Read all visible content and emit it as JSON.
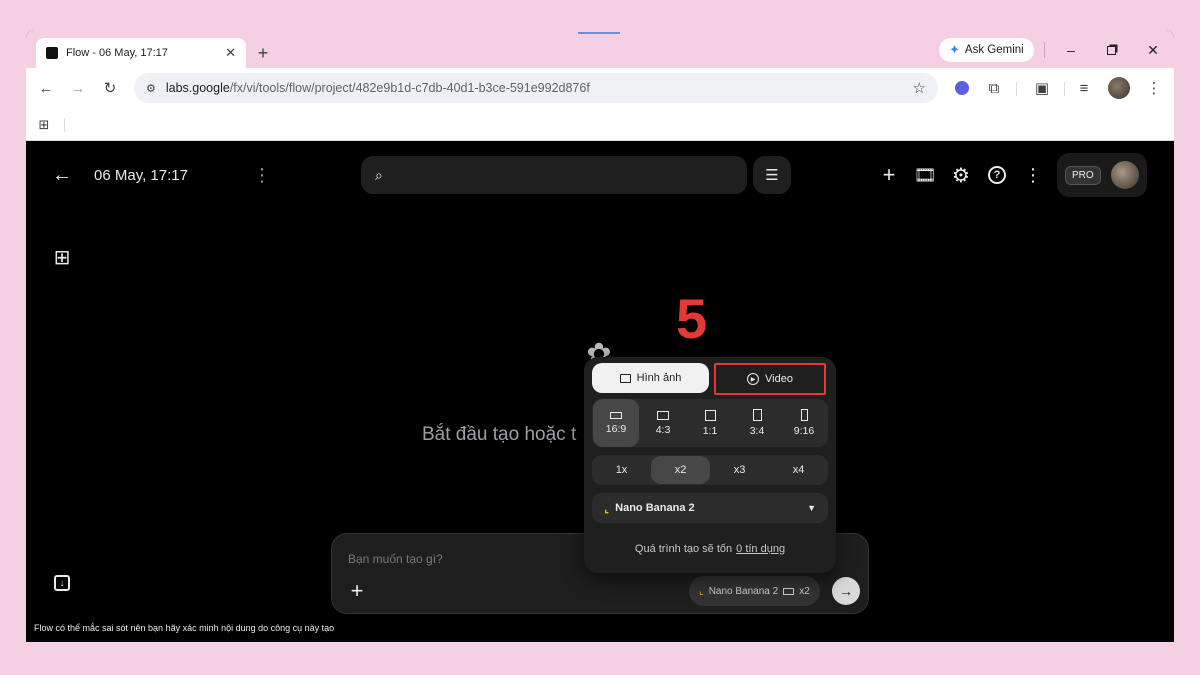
{
  "browser": {
    "tab_title": "Flow - 06 May, 17:17",
    "new_tab_symbol": "+",
    "ask_gemini_label": "Ask Gemini",
    "url_host": "labs.google",
    "url_path": "/fx/vi/tools/flow/project/482e9b1d-c7db-40d1-b3ce-591e992d876f"
  },
  "app": {
    "project_title": "06 May, 17:17",
    "pro_badge": "PRO",
    "empty_state_text": "Bắt đầu tạo hoặc t",
    "prompt_placeholder": "Bạn muốn tạo gì?",
    "prompt_chip_model": "Nano Banana 2",
    "prompt_chip_count": "x2",
    "footer_disclaimer": "Flow có thể mắc sai sót nên bạn hãy xác minh nội dung do công cụ này tạo",
    "annotation_number": "5"
  },
  "popover": {
    "image_tab_label": "Hình ảnh",
    "video_tab_label": "Video",
    "aspect_ratios": [
      "16:9",
      "4:3",
      "1:1",
      "3:4",
      "9:16"
    ],
    "selected_ratio": "16:9",
    "multipliers": [
      "1x",
      "x2",
      "x3",
      "x4"
    ],
    "selected_multiplier": "x2",
    "model_label": "Nano Banana 2",
    "cost_text": "Quá trình tạo sẽ tốn",
    "cost_link": "0 tín dụng"
  },
  "colors": {
    "page_background": "#f5d0e2",
    "app_background": "#000000",
    "annotation_red": "#e53935",
    "banana_accent": "#f4b400"
  }
}
